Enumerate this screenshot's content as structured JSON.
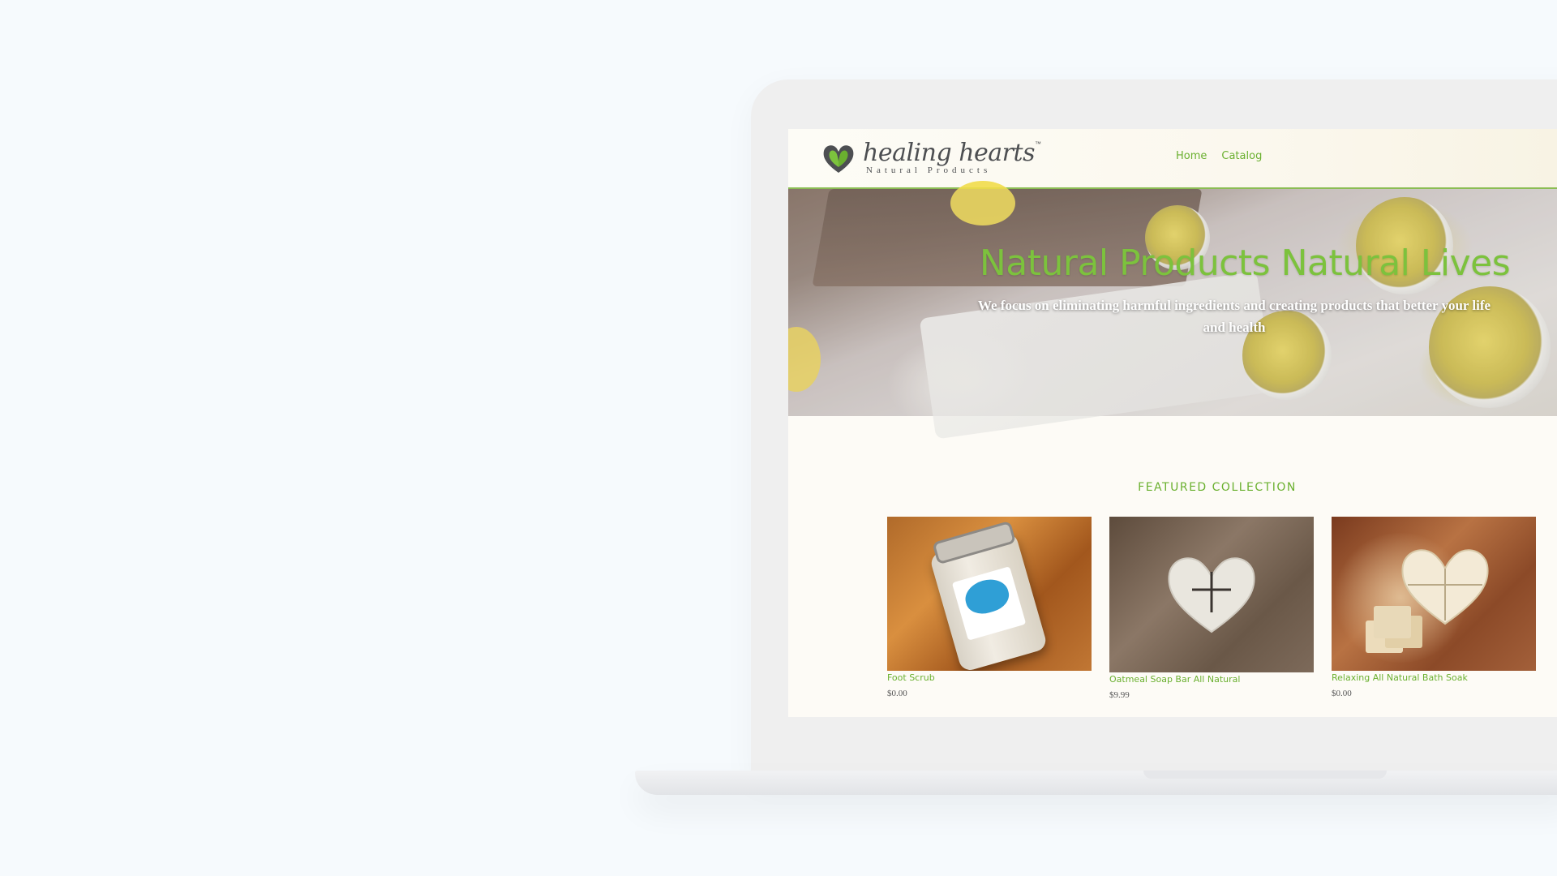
{
  "site": {
    "logo": {
      "name": "healing hearts",
      "trademark": "™",
      "subtitle": "Natural Products"
    },
    "nav": [
      {
        "label": "Home"
      },
      {
        "label": "Catalog"
      }
    ],
    "hero": {
      "title": "Natural Products Natural Lives",
      "subtitle": "We focus on eliminating harmful ingredients and creating products that better your life and health"
    },
    "featured": {
      "title": "FEATURED COLLECTION",
      "products": [
        {
          "name": "Foot Scrub",
          "price": "$0.00"
        },
        {
          "name": "Oatmeal Soap Bar All Natural",
          "price": "$9.99"
        },
        {
          "name": "Relaxing All Natural Bath Soak",
          "price": "$0.00"
        }
      ]
    }
  },
  "colors": {
    "brand_green": "#6ab02f",
    "hero_title_green": "#7cc23d",
    "header_border": "#8bbd54",
    "page_background": "#f6fafd",
    "screen_background": "#fdfbf6"
  },
  "icons": {
    "logo_mark": "heart-leaf-icon"
  }
}
